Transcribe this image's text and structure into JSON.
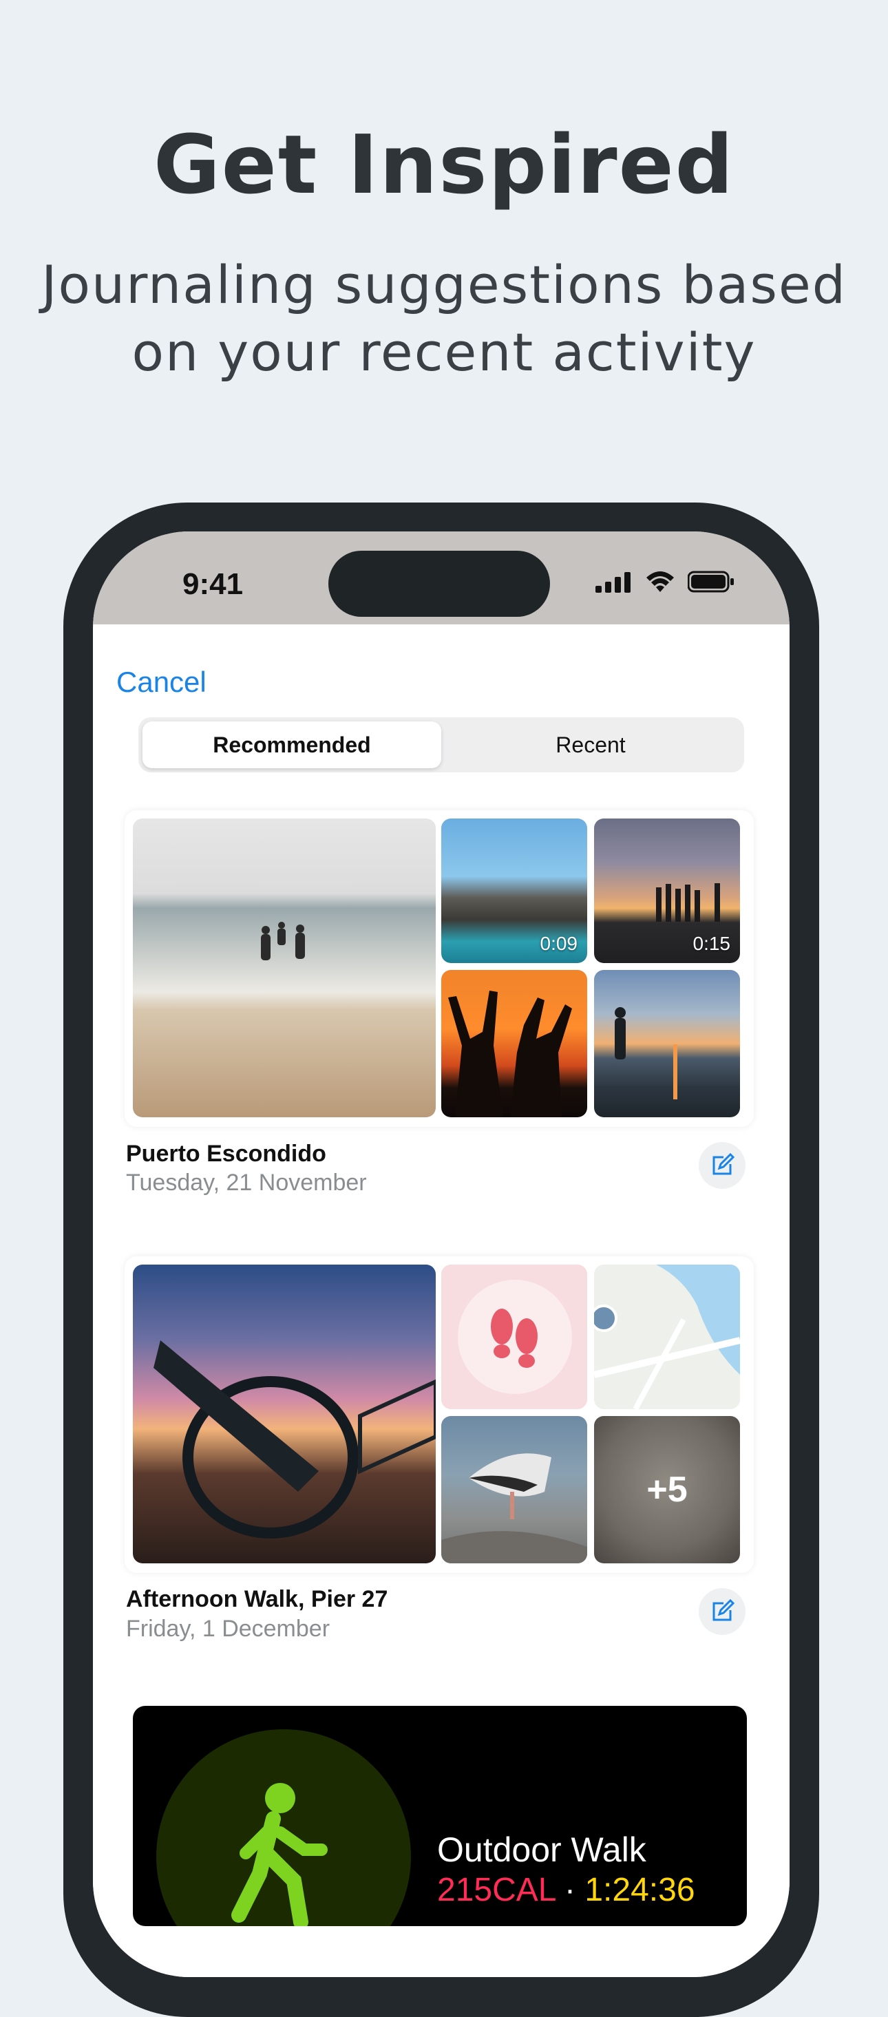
{
  "headline": "Get Inspired",
  "subhead_line1": "Journaling suggestions based",
  "subhead_line2": "on your recent activity",
  "status": {
    "time": "9:41"
  },
  "sheet": {
    "cancel_label": "Cancel",
    "tabs": [
      {
        "label": "Recommended",
        "selected": true
      },
      {
        "label": "Recent",
        "selected": false
      }
    ]
  },
  "suggestions": [
    {
      "title": "Puerto Escondido",
      "date": "Tuesday, 21 November",
      "video_durations": [
        "0:09",
        "0:15"
      ]
    },
    {
      "title": "Afternoon Walk, Pier 27",
      "date": "Friday, 1 December",
      "more_count": "+5"
    }
  ],
  "workout": {
    "title": "Outdoor Walk",
    "calories": "215CAL",
    "separator": "·",
    "duration": "1:24:36"
  },
  "colors": {
    "accent": "#1a84e6",
    "background": "#eaf0f4",
    "calories": "#ff2d55",
    "duration": "#ffd60a",
    "walk_icon": "#7ed321"
  }
}
